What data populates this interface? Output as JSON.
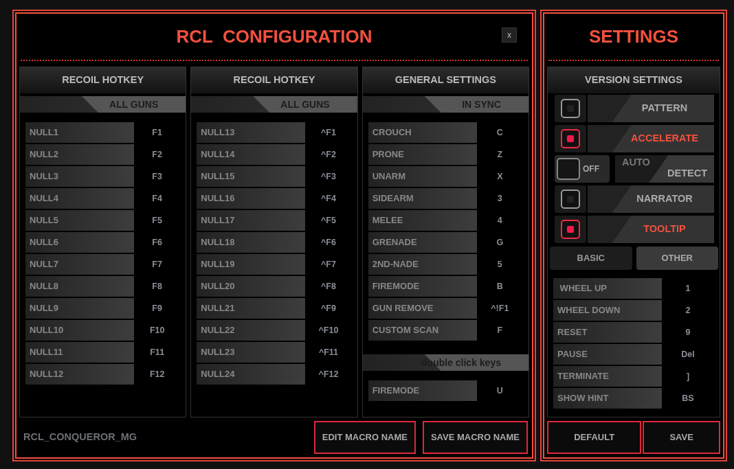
{
  "window": {
    "title": "RCL  CONFIGURATION",
    "close": "x"
  },
  "panels": [
    {
      "title": "RECOIL HOTKEY",
      "subtitle": "ALL GUNS",
      "bindings": [
        {
          "action": "NULL1",
          "key": "F1"
        },
        {
          "action": "NULL2",
          "key": "F2"
        },
        {
          "action": "NULL3",
          "key": "F3"
        },
        {
          "action": "NULL4",
          "key": "F4"
        },
        {
          "action": "NULL5",
          "key": "F5"
        },
        {
          "action": "NULL6",
          "key": "F6"
        },
        {
          "action": "NULL7",
          "key": "F7"
        },
        {
          "action": "NULL8",
          "key": "F8"
        },
        {
          "action": "NULL9",
          "key": "F9"
        },
        {
          "action": "NULL10",
          "key": "F10"
        },
        {
          "action": "NULL11",
          "key": "F11"
        },
        {
          "action": "NULL12",
          "key": "F12"
        }
      ]
    },
    {
      "title": "RECOIL HOTKEY",
      "subtitle": "ALL GUNS",
      "bindings": [
        {
          "action": "NULL13",
          "key": "^F1"
        },
        {
          "action": "NULL14",
          "key": "^F2"
        },
        {
          "action": "NULL15",
          "key": "^F3"
        },
        {
          "action": "NULL16",
          "key": "^F4"
        },
        {
          "action": "NULL17",
          "key": "^F5"
        },
        {
          "action": "NULL18",
          "key": "^F6"
        },
        {
          "action": "NULL19",
          "key": "^F7"
        },
        {
          "action": "NULL20",
          "key": "^F8"
        },
        {
          "action": "NULL21",
          "key": "^F9"
        },
        {
          "action": "NULL22",
          "key": "^F10"
        },
        {
          "action": "NULL23",
          "key": "^F11"
        },
        {
          "action": "NULL24",
          "key": "^F12"
        }
      ]
    },
    {
      "title": "GENERAL SETTINGS",
      "subtitle": "IN SYNC",
      "bindings": [
        {
          "action": "CROUCH",
          "key": "C"
        },
        {
          "action": "PRONE",
          "key": "Z"
        },
        {
          "action": "UNARM",
          "key": "X"
        },
        {
          "action": "SIDEARM",
          "key": "3"
        },
        {
          "action": "MELEE",
          "key": "4"
        },
        {
          "action": "GRENADE",
          "key": "G"
        },
        {
          "action": "2ND-NADE",
          "key": "5"
        },
        {
          "action": "FIREMODE",
          "key": "B"
        },
        {
          "action": "GUN REMOVE",
          "key": "^!F1"
        },
        {
          "action": "CUSTOM SCAN",
          "key": "F"
        }
      ],
      "extra_section": {
        "subtitle": "double click keys",
        "bindings": [
          {
            "action": "FIREMODE",
            "key": "U"
          }
        ]
      }
    }
  ],
  "macro_name": "RCL_CONQUEROR_MG",
  "buttons": [
    "EDIT MACRO NAME",
    "SAVE MACRO NAME"
  ],
  "settings": {
    "title": "SETTINGS",
    "section_title": "VERSION SETTINGS",
    "options": [
      {
        "kind": "checkbox",
        "label": "PATTERN",
        "checked": false
      },
      {
        "kind": "checkbox",
        "label": "ACCELERATE",
        "checked": true
      },
      {
        "kind": "switch",
        "label_1": "AUTO",
        "label_2": "DETECT",
        "state_text": "OFF",
        "on": false
      },
      {
        "kind": "checkbox",
        "label": "NARRATOR",
        "checked": false
      },
      {
        "kind": "checkbox",
        "label": "TOOLTIP",
        "checked": true
      }
    ],
    "tabs": [
      {
        "label": "BASIC",
        "selected": false
      },
      {
        "label": "OTHER",
        "selected": true
      }
    ],
    "bindings": [
      {
        "action": " WHEEL UP",
        "key": "1"
      },
      {
        "action": "WHEEL DOWN",
        "key": "2"
      },
      {
        "action": "RESET",
        "key": "9"
      },
      {
        "action": "PAUSE",
        "key": "Del"
      },
      {
        "action": "TERMINATE",
        "key": "]"
      },
      {
        "action": "SHOW HINT",
        "key": "BS"
      }
    ],
    "buttons": [
      "DEFAULT",
      "SAVE"
    ]
  }
}
